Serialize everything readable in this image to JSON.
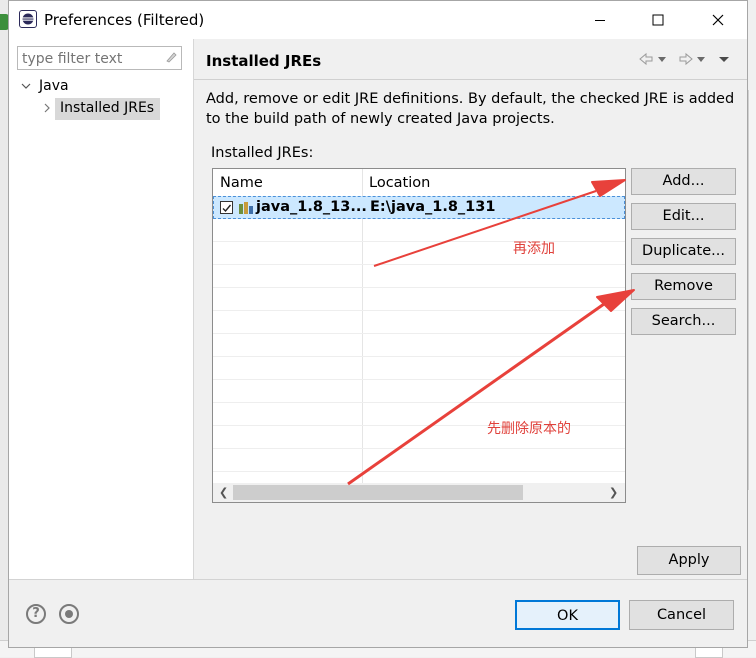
{
  "dialog": {
    "title": "Preferences (Filtered)"
  },
  "tree": {
    "filter_placeholder": "type filter text",
    "items": [
      {
        "label": "Java"
      },
      {
        "label": "Installed JREs"
      }
    ]
  },
  "page": {
    "title": "Installed JREs",
    "description": "Add, remove or edit JRE definitions. By default, the checked JRE is added to the build path of newly created Java projects.",
    "table_label": "Installed JREs:",
    "columns": [
      "Name",
      "Location"
    ],
    "rows": [
      {
        "name": "java_1.8_13...",
        "location": "E:\\java_1.8_131",
        "checked": true
      }
    ]
  },
  "buttons": {
    "add": "Add...",
    "edit": "Edit...",
    "duplicate": "Duplicate...",
    "remove": "Remove",
    "search": "Search...",
    "apply": "Apply",
    "ok": "OK",
    "cancel": "Cancel"
  },
  "annotations": {
    "note_add": "再添加",
    "note_remove": "先删除原本的",
    "arrow_color": "#e8413b"
  },
  "colors": {
    "selection": "#cce8ff",
    "default_button_border": "#0078d7"
  }
}
